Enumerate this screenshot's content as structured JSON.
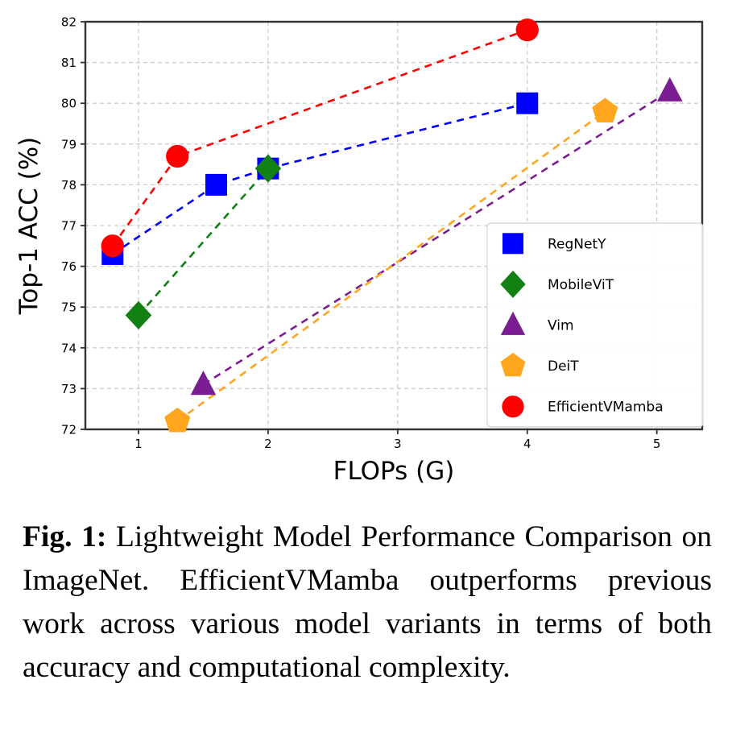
{
  "figure": {
    "caption_tag": "Fig. 1:",
    "caption_text": "Lightweight Model Performance Comparison on ImageNet. EfficientVMamba outperforms previous work across various model variants in terms of both accuracy and computational complexity."
  },
  "chart_data": {
    "type": "line",
    "title": "",
    "xlabel": "FLOPs (G)",
    "ylabel": "Top-1 ACC (%)",
    "xlim": [
      0.59,
      5.35
    ],
    "ylim": [
      72,
      82
    ],
    "xticks": [
      1,
      2,
      3,
      4,
      5
    ],
    "yticks": [
      72,
      73,
      74,
      75,
      76,
      77,
      78,
      79,
      80,
      81,
      82
    ],
    "xtick_labels": [
      "1",
      "2",
      "3",
      "4",
      "5"
    ],
    "ytick_labels": [
      "72",
      "73",
      "74",
      "75",
      "76",
      "77",
      "78",
      "79",
      "80",
      "81",
      "82"
    ],
    "grid": true,
    "grid_style": "dashed",
    "grid_color": "#cccccc",
    "line_style": "dashed",
    "legend_position": "lower right",
    "series": [
      {
        "name": "RegNetY",
        "color": "#0000ff",
        "marker": "square",
        "x": [
          0.8,
          1.6,
          2.0,
          4.0
        ],
        "y": [
          76.3,
          78.0,
          78.4,
          80.0
        ]
      },
      {
        "name": "MobileViT",
        "color": "#128012",
        "marker": "diamond",
        "x": [
          1.0,
          2.0
        ],
        "y": [
          74.8,
          78.4
        ]
      },
      {
        "name": "Vim",
        "color": "#7b1d92",
        "marker": "triangle",
        "x": [
          1.5,
          5.1
        ],
        "y": [
          73.1,
          80.3
        ]
      },
      {
        "name": "DeiT",
        "color": "#ffa51e",
        "marker": "pentagon",
        "x": [
          1.3,
          4.6
        ],
        "y": [
          72.2,
          79.8
        ]
      },
      {
        "name": "EfficientVMamba",
        "color": "#ff0000",
        "marker": "circle",
        "x": [
          0.8,
          1.3,
          4.0
        ],
        "y": [
          76.5,
          78.7,
          81.8
        ]
      }
    ],
    "legend": [
      {
        "label": "RegNetY",
        "color": "#0000ff",
        "marker": "square"
      },
      {
        "label": "MobileViT",
        "color": "#128012",
        "marker": "diamond"
      },
      {
        "label": "Vim",
        "color": "#7b1d92",
        "marker": "triangle"
      },
      {
        "label": "DeiT",
        "color": "#ffa51e",
        "marker": "pentagon"
      },
      {
        "label": "EfficientVMamba",
        "color": "#ff0000",
        "marker": "circle"
      }
    ]
  }
}
